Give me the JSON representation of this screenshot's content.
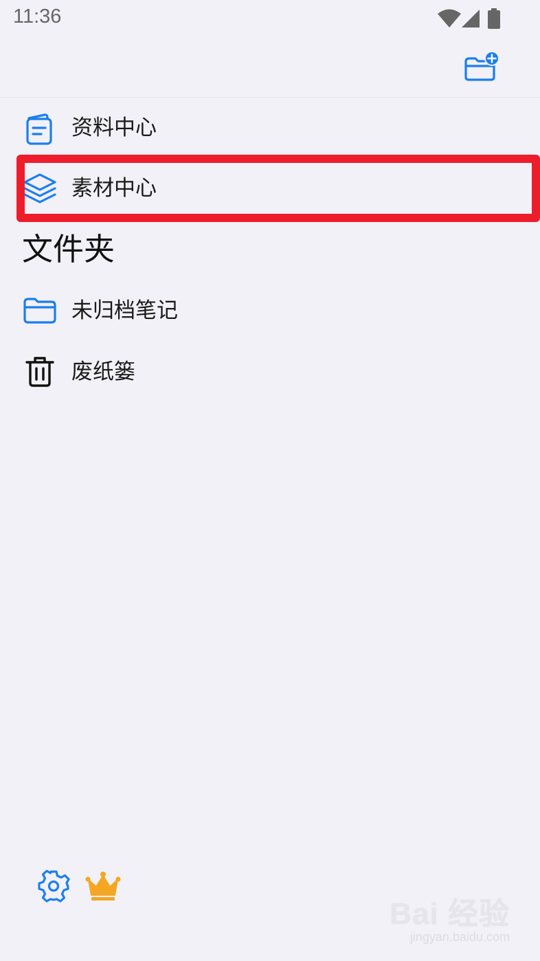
{
  "status_bar": {
    "time": "11:36",
    "icons": [
      "wifi-icon",
      "cellular-signal-icon",
      "battery-icon"
    ]
  },
  "header": {
    "new_folder_icon": "folder-plus-icon",
    "accent_color": "#1a7ef0"
  },
  "library": {
    "items": [
      {
        "label": "资料中心",
        "icon": "document-stack-icon"
      },
      {
        "label": "素材中心",
        "icon": "layers-icon"
      }
    ]
  },
  "folders": {
    "title": "文件夹",
    "items": [
      {
        "label": "未归档笔记",
        "icon": "folder-icon"
      },
      {
        "label": "废纸篓",
        "icon": "trash-icon"
      }
    ]
  },
  "footer": {
    "settings_icon": "gear-icon",
    "premium_icon": "crown-icon",
    "premium_color": "#f5a623"
  },
  "watermark": {
    "main": "Bai 经验",
    "sub": "jingyan.baidu.com"
  },
  "highlight_color": "#ee1d2c"
}
